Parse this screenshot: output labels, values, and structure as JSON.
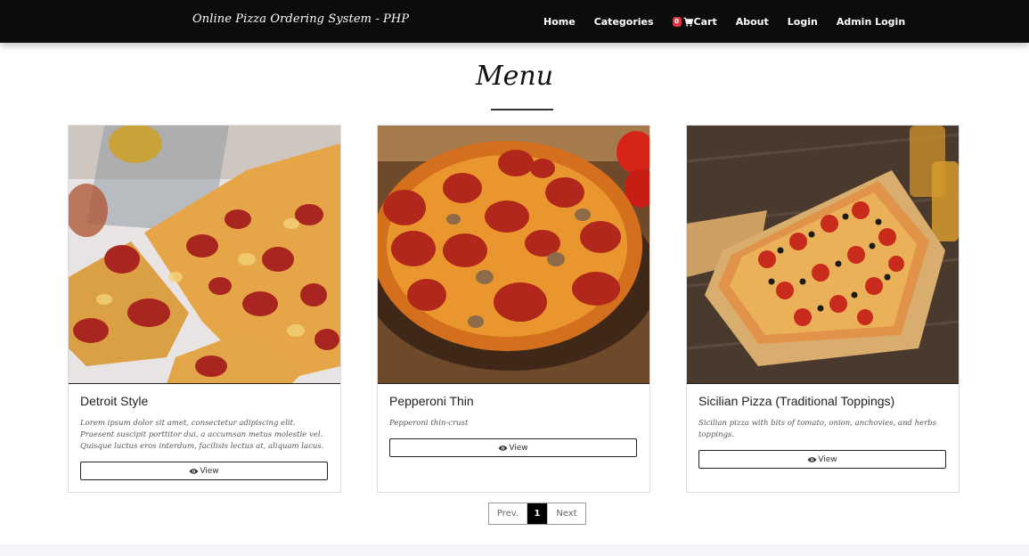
{
  "navbar": {
    "brand": "Online Pizza Ordering System - PHP",
    "links": {
      "home": "Home",
      "categories": "Categories",
      "cart": "Cart",
      "cart_count": "0",
      "about": "About",
      "login": "Login",
      "admin_login": "Admin Login"
    }
  },
  "menu": {
    "title": "Menu",
    "items": [
      {
        "name": "Detroit Style",
        "description": "Lorem ipsum dolor sit amet, consectetur adipiscing elit. Praesent suscipit porttitor dui, a accumsan metus molestie vel. Quisque luctus eros interdum, facilisis lectus at, aliquam lacus.",
        "button": "View",
        "image": "detroit-style-pizza-photo"
      },
      {
        "name": "Pepperoni Thin",
        "description": "Pepperoni thin-crust",
        "button": "View",
        "image": "pepperoni-thin-pizza-photo"
      },
      {
        "name": "Sicilian Pizza (Traditional Toppings)",
        "description": "Sicilian pizza with bits of tomato, onion, anchovies, and herbs toppings.",
        "button": "View",
        "image": "sicilian-pizza-photo"
      }
    ]
  },
  "pagination": {
    "prev": "Prev.",
    "current": "1",
    "next": "Next"
  },
  "colors": {
    "navbar_bg": "#0c0c0c",
    "cart_badge": "#dc3545",
    "pagination_active": "#000000"
  }
}
